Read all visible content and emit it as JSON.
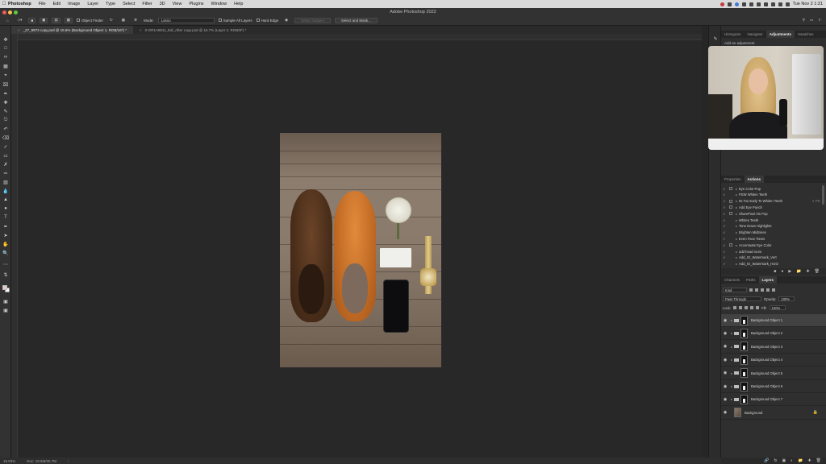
{
  "menubar": {
    "app": "Photoshop",
    "items": [
      "File",
      "Edit",
      "Image",
      "Layer",
      "Type",
      "Select",
      "Filter",
      "3D",
      "View",
      "Plugins",
      "Window",
      "Help"
    ],
    "clock": "Tue Nov 2 1:21"
  },
  "window": {
    "title": "Adobe Photoshop 2022"
  },
  "options": {
    "object_finder": "Object Finder",
    "mode_label": "Mode:",
    "mode_value": "Lasso",
    "sample_all_layers": "Sample All Layers",
    "hard_edge": "Hard Edge",
    "select_subject": "Select Subject",
    "select_and_mask": "Select and Mask..."
  },
  "tabs": [
    {
      "label": "_27_9973 copy.psd @ 15.5% (Background Object 1, RGB/16*) *",
      "active": true
    },
    {
      "label": "0-GR1A9911_Edi_After copy.psd @ 16.7% (Layer 2, RGB/8*) *",
      "active": false
    }
  ],
  "panels": {
    "top_tabs": [
      "Histogram",
      "Navigator",
      "Adjustments",
      "Swatches"
    ],
    "top_active": "Adjustments",
    "add_adjustment": "Add an adjustment",
    "mid_tabs": [
      "Properties",
      "Actions"
    ],
    "mid_active": "Actions",
    "bottom_tabs": [
      "Channels",
      "Paths",
      "Layers"
    ],
    "bottom_active": "Layers"
  },
  "actions": [
    {
      "name": "Eye Color Pop",
      "box": true,
      "key": ""
    },
    {
      "name": "PSW Whiten Teeth",
      "box": false,
      "key": ""
    },
    {
      "name": "Its Too Early To Whiten Teeth",
      "box": true,
      "key": "⇧ F3"
    },
    {
      "name": "Add Eye Punch",
      "box": true,
      "key": ""
    },
    {
      "name": "SharePixel Iris Pop",
      "box": true,
      "key": ""
    },
    {
      "name": "Whiten Teeth",
      "box": false,
      "key": ""
    },
    {
      "name": "Tone Down Highlights",
      "box": false,
      "key": ""
    },
    {
      "name": "Brighten Midtones",
      "box": false,
      "key": ""
    },
    {
      "name": "Even Face Tones",
      "box": false,
      "key": ""
    },
    {
      "name": "Accentuate Eye Color",
      "box": true,
      "key": ""
    },
    {
      "name": "add head room",
      "box": false,
      "key": ""
    },
    {
      "name": "Add_IG_Watermark_Vert",
      "box": false,
      "key": ""
    },
    {
      "name": "Add_IG_Watermark_Horiz",
      "box": false,
      "key": ""
    }
  ],
  "layers_controls": {
    "kind": "Kind",
    "blend_mode": "Pass Through",
    "opacity_label": "Opacity:",
    "opacity_value": "100%",
    "lock_label": "Lock:",
    "fill_label": "Fill:",
    "fill_value": "100%"
  },
  "layers": [
    {
      "name": "Background Object 1",
      "selected": true,
      "group": true
    },
    {
      "name": "Background Object 2",
      "selected": false,
      "group": true
    },
    {
      "name": "Background Object 3",
      "selected": false,
      "group": true
    },
    {
      "name": "Background Object 4",
      "selected": false,
      "group": true
    },
    {
      "name": "Background Object 5",
      "selected": false,
      "group": true
    },
    {
      "name": "Background Object 6",
      "selected": false,
      "group": true
    },
    {
      "name": "Background Object 7",
      "selected": false,
      "group": true
    },
    {
      "name": "Background",
      "selected": false,
      "group": false
    }
  ],
  "status": {
    "zoom": "15.53%",
    "doc": "Doc: 19.6M/25.7M"
  },
  "colors": {
    "foreground": "#e8c9c6",
    "background": "#ffffff"
  }
}
